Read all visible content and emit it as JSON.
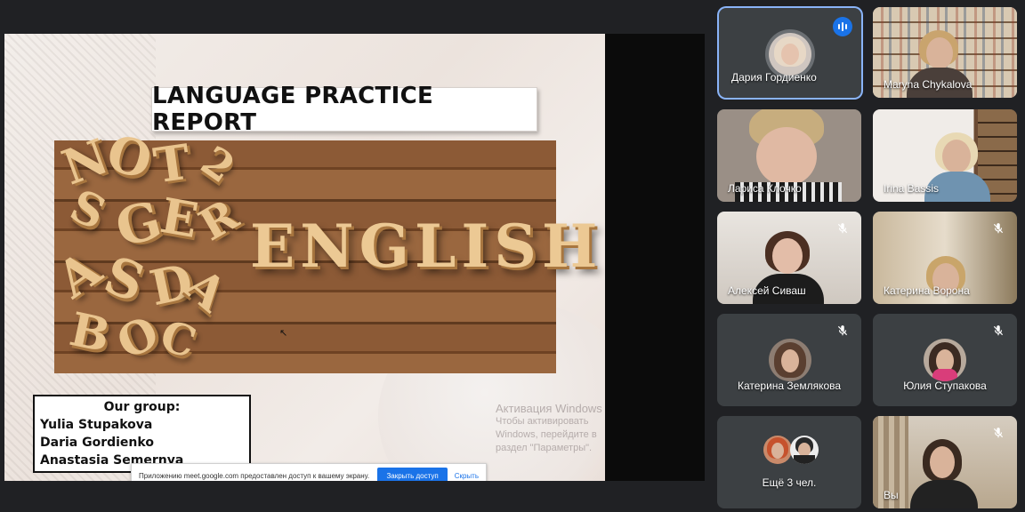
{
  "slide": {
    "title": "LANGUAGE PRACTICE REPORT",
    "word": "ENGLISH",
    "group_heading": "Our group:",
    "members": [
      "Yulia Stupakova",
      "Daria Gordienko",
      "Anastasia Semernya"
    ]
  },
  "watermark": {
    "line1": "Активация Windows",
    "line2": "Чтобы активировать Windows, перейдите в",
    "line3": "раздел \"Параметры\"."
  },
  "share_notice": {
    "text": "Приложению meet.google.com предоставлен доступ к вашему экрану.",
    "stop_label": "Закрыть доступ",
    "hide_label": "Скрыть"
  },
  "participants": [
    {
      "name": "Дария Гордиенко",
      "state": "speaking"
    },
    {
      "name": "Maryna Chykalova",
      "state": "video"
    },
    {
      "name": "Лариса Клочко",
      "state": "video"
    },
    {
      "name": "Irina Bassis",
      "state": "video"
    },
    {
      "name": "Алексей Сиваш",
      "state": "muted"
    },
    {
      "name": "Катерина Ворона",
      "state": "muted"
    },
    {
      "name": "Катерина Землякова",
      "state": "muted"
    },
    {
      "name": "Юлия Ступакова",
      "state": "muted"
    },
    {
      "name": "Ещё 3 чел.",
      "state": "overflow"
    },
    {
      "name": "Вы",
      "state": "muted"
    }
  ],
  "colors": {
    "background": "#202124",
    "tile": "#3c4043",
    "accent": "#1a73e8",
    "active_border": "#8ab4f8"
  },
  "icons": {
    "speaking": "audio-level-icon",
    "muted": "mic-off-icon"
  }
}
